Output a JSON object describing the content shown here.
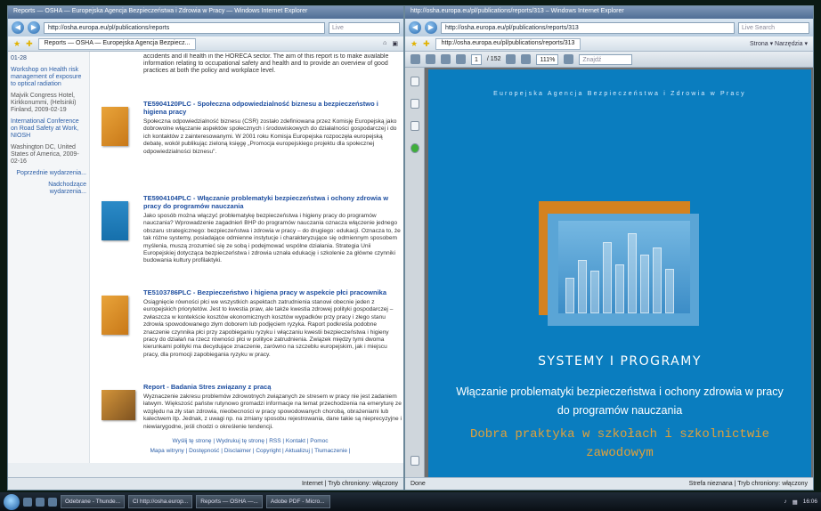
{
  "left_window": {
    "title": "Reports — OSHA — Europejska Agencja Bezpieczeństwa i Zdrowia w Pracy — Windows Internet Explorer",
    "address": "http://osha.europa.eu/pl/publications/reports",
    "search": "Live",
    "tab": "Reports — OSHA — Europejska Agencja Bezpiecz...",
    "sidebar": {
      "date_top": "01-28",
      "events": [
        {
          "title": "Workshop on Health risk management of exposure to optical radiation",
          "meta": "Majvik Congress Hotel, Kirkkonummi, (Helsinki) Finland, 2009-02-19"
        },
        {
          "title": "International Conference on Road Safety at Work, NIOSH",
          "meta": "Washington DC, United States of America, 2009-02-16"
        }
      ],
      "prev": "Poprzednie wydarzenia...",
      "next": "Nadchodzące wydarzenia..."
    },
    "intro": "accidents and ill health in the HORECA sector. The aim of this report is to make available information relating to occupational safety and health and to provide an overview of good practices at both the policy and workplace level.",
    "items": [
      {
        "title": "TE5904120PLC - Społeczna odpowiedzialność biznesu a bezpieczeństwo i higiena pracy",
        "desc": "Społeczna odpowiedzialność biznesu (CSR) zostało zdefiniowana przez Komisję Europejską jako dobrowolne włączanie aspektów społecznych i środowiskowych do działalności gospodarczej i do ich kontaktów z zainteresowanymi. W 2001 roku Komisja Europejska rozpoczęła europejską debatę, wokół publikując zieloną księgę „Promocja europejskiego projektu dla społecznej odpowiedzialności biznesu\"."
      },
      {
        "title": "TE5904104PLC - Włączanie problematyki bezpieczeństwa i ochony zdrowia w pracy do programów nauczania",
        "desc": "Jako sposób można włączyć problematykę bezpieczeństwa i higieny pracy do programów nauczania? Wprowadzenie zagadnień BHP do programów nauczania oznacza włączenie jednego obszaru strategicznego: bezpieczeństwa i zdrowia w pracy – do drugiego: edukacji. Oznacza to, że tak różne systemy, posiadające odmienne instytucje i charakteryzujące się odmiennym sposobem myślenia, muszą zrozumieć się ze sobą i podejmować wspólne działania. Strategia Unii Europejskiej dotycząca bezpieczeństwa i zdrowia uznała edukację i szkolenie za główne czynniki budowania kultury profilaktyki."
      },
      {
        "title": "TE5103786PLC - Bezpieczeństwo i higiena pracy w aspekcie płci pracownika",
        "desc": "Osiągnięcie równości płci we wszystkich aspektach zatrudnienia stanowi obecnie jeden z europejskich priorytetów. Jest to kwestia praw, ale także kwestia zdrowej polityki gospodarczej – zwłaszcza w kontekście kosztów ekonomicznych kosztów wypadków przy pracy i złego stanu zdrowia spowodowanego złym doborem lub podjęciem ryzyka. Raport podkreśla podobne znaczenie czynnika płci przy zapobieganiu ryzyku i włączaniu kwestii bezpieczeństwa i higieny pracy do działań na rzecz równości płci w polityce zatrudnienia. Związek między tymi dwoma kierunkami polityki ma decydujące znaczenie, zarówno na szczeblu europejskim, jak i miejscu pracy, dla promocji zapobiegania ryzyku w pracy."
      },
      {
        "title": "Report - Badania Stres związany z pracą",
        "desc": "Wyznaczenie zakresu problemów zdrowotnych związanych ze stresem w pracy nie jest zadaniem łatwym. Większość państw rutynowo gromadzi informacje na temat przechodzenia na emeryturę ze względu na zły stan zdrowia, nieobecności w pracy spowodowanych chorobą, obrażeniami lub kalectwem itp. Jednak, z uwagi np. na zmiany sposobu rejestrowania, dane takie są nieprecyzyjne i niewiarygodne, jeśli chodzi o określenie tendencji."
      }
    ],
    "footer_line1": "Wyślij tę stronę | Wydrukuj tę stronę | RSS | Kontakt | Pomoc",
    "footer_line2": "Mapa witryny | Dostępność | Disclaimer | Copyright | Aktualizuj | Tłumaczenie |",
    "status": "Internet | Tryb chroniony: włączony"
  },
  "right_window": {
    "title": "http://osha.europa.eu/pl/publications/reports/313 – Windows Internet Explorer",
    "address": "http://osha.europa.eu/pl/publications/reports/313",
    "search": "Live Search",
    "tab": "http://osha.europa.eu/pl/publications/reports/313",
    "tools": "Strona ▾  Narzędzia ▾",
    "page_num": "1",
    "page_total": "/ 152",
    "zoom": "111%",
    "find": "Znajdź",
    "cover": {
      "agency": "Europejska Agencja Bezpieczeństwa i Zdrowia w Pracy",
      "series": "SYSTEMY I PROGRAMY",
      "title_line1": "Włączanie problematyki bezpieczeństwa i ochony zdrowia w pracy",
      "title_line2": "do programów nauczania",
      "subtitle_line1": "Dobra praktyka w szkołach i szkolnictwie",
      "subtitle_line2": "zawodowym"
    },
    "status_left": "Done",
    "status_right": "Strefa nieznana | Tryb chroniony: włączony"
  },
  "taskbar": {
    "items": [
      "Odebrane - Thunde...",
      "Cl http://osha.europ...",
      "Reports — OSHA —...",
      "Adobe PDF - Micro..."
    ],
    "clock": "16:06"
  }
}
